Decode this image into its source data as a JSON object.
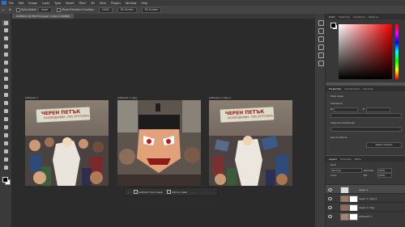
{
  "menu": [
    "File",
    "Edit",
    "Image",
    "Layer",
    "Type",
    "Select",
    "Filter",
    "3D",
    "View",
    "Plugins",
    "Window",
    "Help"
  ],
  "options": {
    "auto_select_label": "Auto-Select:",
    "auto_select_value": "Layer",
    "transform_controls": "Show Transform Controls",
    "zoom": "100%",
    "fit_screen": "Fit Screen",
    "fill_screen": "Fill Screen"
  },
  "document_tab": "Untitled-1 @ 66.7% (Layer 1 copy 2, RGB/8)",
  "artboards": [
    {
      "label": "Artboard 1"
    },
    {
      "label": "Artboard 1 copy"
    },
    {
      "label": "Artboard 1 copy 2"
    }
  ],
  "banner": {
    "line1": "ЧЕРЕН ПЕТЪК",
    "line2": "РАЗПРОДАЖБА -70% ОТСТЪПКА"
  },
  "context_bar": {
    "generate": "Subtract from mask",
    "add": "Add to mask"
  },
  "color_panel": {
    "tabs": [
      "Color",
      "Swatches",
      "Gradients",
      "Patterns"
    ]
  },
  "properties_panel": {
    "tabs": [
      "Properties",
      "Adjustments",
      "Libraries"
    ],
    "type_label": "Pixel Layer",
    "transform": "Transform",
    "w_label": "W",
    "h_label": "H",
    "align": "Align and Distribute",
    "quick_actions": "Quick Actions",
    "select_subject": "Select subject"
  },
  "layers_panel": {
    "tabs": [
      "Layers",
      "Channels",
      "Paths"
    ],
    "kind_label": "Kind",
    "mode": "Normal",
    "opacity_label": "Opacity:",
    "opacity": "100%",
    "lock_label": "Lock:",
    "fill_label": "Fill:",
    "fill": "100%",
    "layers": [
      {
        "name": "Layer 1"
      },
      {
        "name": "Layer 1 copy 2"
      },
      {
        "name": "Layer 1 copy"
      },
      {
        "name": "Artboard 1"
      }
    ]
  },
  "colors": {
    "accent": "#2a6fdb",
    "banner_red": "#a3181b",
    "picker_hue": "#f20000"
  }
}
